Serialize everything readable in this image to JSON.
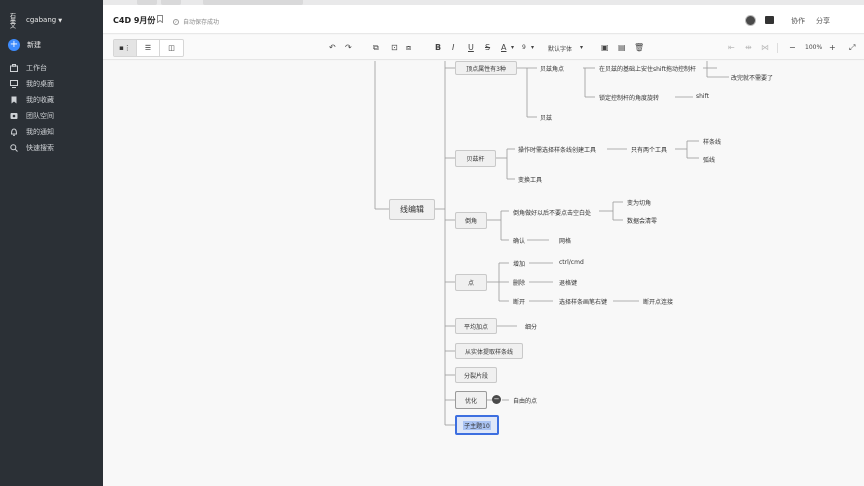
{
  "sidebar": {
    "username": "cgabang",
    "new_label": "新建",
    "items": [
      {
        "icon": "briefcase-icon",
        "label": "工作台"
      },
      {
        "icon": "desktop-icon",
        "label": "我的桌面"
      },
      {
        "icon": "bookmark-icon",
        "label": "我的收藏"
      },
      {
        "icon": "team-icon",
        "label": "团队空间"
      },
      {
        "icon": "bell-icon",
        "label": "我的通知"
      },
      {
        "icon": "search-icon",
        "label": "快速搜索"
      }
    ]
  },
  "header": {
    "title": "C4D 9月份",
    "save_status": "自动保存成功",
    "collab_label": "协作",
    "share_label": "分享"
  },
  "toolbar": {
    "font_size": "9",
    "font_family": "默认字体",
    "zoom": "100%"
  },
  "mindmap": {
    "root": "线编辑",
    "partial_top": "...",
    "branches": {
      "vertex_attr": "顶点属性有3种",
      "bezier_corner": "贝兹角点",
      "shift_drag": "在贝兹的基础上安住shift拖动控制杆",
      "no_need": "改完就不需要了",
      "lock_angle": "锁定控制杆的角度旋转",
      "shift": "shift",
      "bezier": "贝兹",
      "bezier_pen": "贝兹杆",
      "op_select": "操作时需选择样条线创建工具",
      "only_two": "只有两个工具",
      "spline": "样条线",
      "arc": "弧线",
      "transform": "变换工具",
      "chamfer": "倒角",
      "chamfer_tip": "倒角做好以后不要点击空白处",
      "to_chamfer": "变为切角",
      "reset_zero": "数据会清零",
      "confirm": "确认",
      "lattice": "网格",
      "point": "点",
      "add": "增加",
      "ctrl_cmd": "ctrl/cmd",
      "delete": "删除",
      "backspace": "退格键",
      "disconnect": "断开",
      "right_click": "选择样条画笔右键",
      "break_point": "断开点连接",
      "avg_point": "平均加点",
      "subdivide": "细分",
      "extract": "从实体提取样条线",
      "split": "分裂片段",
      "optimize": "优化",
      "free_point": "自由的点",
      "subtopic": "子主题10"
    }
  }
}
